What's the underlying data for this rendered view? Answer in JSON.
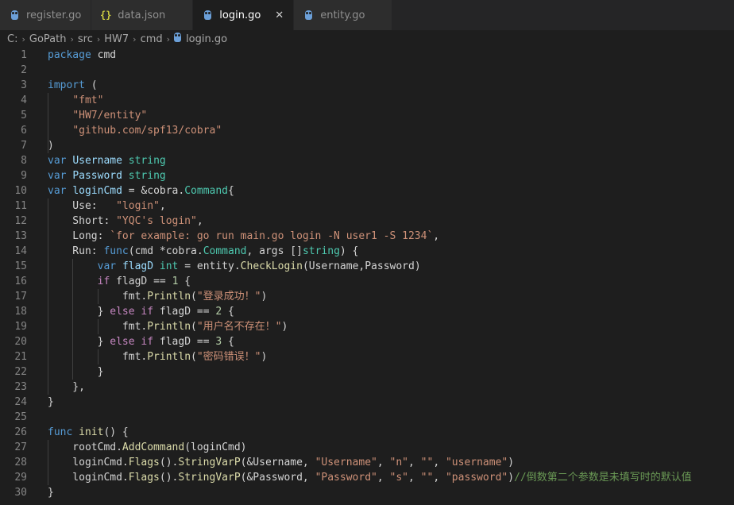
{
  "tabs": [
    {
      "label": "register.go",
      "icon": "go-gopher-icon",
      "active": false
    },
    {
      "label": "data.json",
      "icon": "json-braces-icon",
      "active": false
    },
    {
      "label": "login.go",
      "icon": "go-gopher-icon",
      "active": true,
      "close": "✕"
    },
    {
      "label": "entity.go",
      "icon": "go-gopher-icon",
      "active": false
    }
  ],
  "breadcrumb": {
    "items": [
      "C:",
      "GoPath",
      "src",
      "HW7",
      "cmd"
    ],
    "file": "login.go",
    "separator": "›"
  },
  "colors": {
    "keyword": "#569cd6",
    "control": "#c586c0",
    "string": "#ce9178",
    "type": "#4ec9b0",
    "function": "#dcdcaa",
    "variable": "#9cdcfe",
    "number": "#b5cea8",
    "comment": "#6a9955",
    "text": "#d4d4d4"
  },
  "code": [
    {
      "n": "1",
      "t": [
        [
          "kw",
          "package"
        ],
        [
          "txt",
          " cmd"
        ]
      ]
    },
    {
      "n": "2",
      "t": []
    },
    {
      "n": "3",
      "t": [
        [
          "kw",
          "import"
        ],
        [
          "txt",
          " ("
        ]
      ]
    },
    {
      "n": "4",
      "t": [
        [
          "txt",
          "    "
        ],
        [
          "str",
          "\"fmt\""
        ]
      ]
    },
    {
      "n": "5",
      "t": [
        [
          "txt",
          "    "
        ],
        [
          "str",
          "\"HW7/entity\""
        ]
      ]
    },
    {
      "n": "6",
      "t": [
        [
          "txt",
          "    "
        ],
        [
          "str",
          "\"github.com/spf13/cobra\""
        ]
      ]
    },
    {
      "n": "7",
      "t": [
        [
          "txt",
          ")"
        ]
      ]
    },
    {
      "n": "8",
      "t": [
        [
          "kw",
          "var"
        ],
        [
          "txt",
          " "
        ],
        [
          "var",
          "Username"
        ],
        [
          "txt",
          " "
        ],
        [
          "typ",
          "string"
        ]
      ]
    },
    {
      "n": "9",
      "t": [
        [
          "kw",
          "var"
        ],
        [
          "txt",
          " "
        ],
        [
          "var",
          "Password"
        ],
        [
          "txt",
          " "
        ],
        [
          "typ",
          "string"
        ]
      ]
    },
    {
      "n": "10",
      "t": [
        [
          "kw",
          "var"
        ],
        [
          "txt",
          " "
        ],
        [
          "var",
          "loginCmd"
        ],
        [
          "txt",
          " = &cobra."
        ],
        [
          "typ",
          "Command"
        ],
        [
          "txt",
          "{"
        ]
      ]
    },
    {
      "n": "11",
      "t": [
        [
          "txt",
          "    Use:   "
        ],
        [
          "str",
          "\"login\""
        ],
        [
          "txt",
          ","
        ]
      ]
    },
    {
      "n": "12",
      "t": [
        [
          "txt",
          "    Short: "
        ],
        [
          "str",
          "\"YQC's login\""
        ],
        [
          "txt",
          ","
        ]
      ]
    },
    {
      "n": "13",
      "t": [
        [
          "txt",
          "    Long: "
        ],
        [
          "str",
          "`for example: go run main.go login -N user1 -S 1234`"
        ],
        [
          "txt",
          ","
        ]
      ]
    },
    {
      "n": "14",
      "t": [
        [
          "txt",
          "    Run: "
        ],
        [
          "kw",
          "func"
        ],
        [
          "txt",
          "(cmd *cobra."
        ],
        [
          "typ",
          "Command"
        ],
        [
          "txt",
          ", args []"
        ],
        [
          "typ",
          "string"
        ],
        [
          "txt",
          ") {"
        ]
      ]
    },
    {
      "n": "15",
      "t": [
        [
          "txt",
          "        "
        ],
        [
          "kw",
          "var"
        ],
        [
          "txt",
          " "
        ],
        [
          "var",
          "flagD"
        ],
        [
          "txt",
          " "
        ],
        [
          "typ",
          "int"
        ],
        [
          "txt",
          " = entity."
        ],
        [
          "fn",
          "CheckLogin"
        ],
        [
          "txt",
          "(Username,Password)"
        ]
      ]
    },
    {
      "n": "16",
      "t": [
        [
          "txt",
          "        "
        ],
        [
          "ctl",
          "if"
        ],
        [
          "txt",
          " flagD == "
        ],
        [
          "num",
          "1"
        ],
        [
          "txt",
          " {"
        ]
      ]
    },
    {
      "n": "17",
      "t": [
        [
          "txt",
          "            fmt."
        ],
        [
          "fn",
          "Println"
        ],
        [
          "txt",
          "("
        ],
        [
          "str",
          "\"登录成功！\""
        ],
        [
          "txt",
          ")"
        ]
      ]
    },
    {
      "n": "18",
      "t": [
        [
          "txt",
          "        } "
        ],
        [
          "ctl",
          "else"
        ],
        [
          "txt",
          " "
        ],
        [
          "ctl",
          "if"
        ],
        [
          "txt",
          " flagD == "
        ],
        [
          "num",
          "2"
        ],
        [
          "txt",
          " {"
        ]
      ]
    },
    {
      "n": "19",
      "t": [
        [
          "txt",
          "            fmt."
        ],
        [
          "fn",
          "Println"
        ],
        [
          "txt",
          "("
        ],
        [
          "str",
          "\"用户名不存在！\""
        ],
        [
          "txt",
          ")"
        ]
      ]
    },
    {
      "n": "20",
      "t": [
        [
          "txt",
          "        } "
        ],
        [
          "ctl",
          "else"
        ],
        [
          "txt",
          " "
        ],
        [
          "ctl",
          "if"
        ],
        [
          "txt",
          " flagD == "
        ],
        [
          "num",
          "3"
        ],
        [
          "txt",
          " {"
        ]
      ]
    },
    {
      "n": "21",
      "t": [
        [
          "txt",
          "            fmt."
        ],
        [
          "fn",
          "Println"
        ],
        [
          "txt",
          "("
        ],
        [
          "str",
          "\"密码错误！\""
        ],
        [
          "txt",
          ")"
        ]
      ]
    },
    {
      "n": "22",
      "t": [
        [
          "txt",
          "        }"
        ]
      ]
    },
    {
      "n": "23",
      "t": [
        [
          "txt",
          "    },"
        ]
      ]
    },
    {
      "n": "24",
      "t": [
        [
          "txt",
          "}"
        ]
      ]
    },
    {
      "n": "25",
      "t": []
    },
    {
      "n": "26",
      "t": [
        [
          "kw",
          "func"
        ],
        [
          "txt",
          " "
        ],
        [
          "fn",
          "init"
        ],
        [
          "txt",
          "() {"
        ]
      ]
    },
    {
      "n": "27",
      "t": [
        [
          "txt",
          "    rootCmd."
        ],
        [
          "fn",
          "AddCommand"
        ],
        [
          "txt",
          "(loginCmd)"
        ]
      ]
    },
    {
      "n": "28",
      "t": [
        [
          "txt",
          "    loginCmd."
        ],
        [
          "fn",
          "Flags"
        ],
        [
          "txt",
          "()."
        ],
        [
          "fn",
          "StringVarP"
        ],
        [
          "txt",
          "(&Username, "
        ],
        [
          "str",
          "\"Username\""
        ],
        [
          "txt",
          ", "
        ],
        [
          "str",
          "\"n\""
        ],
        [
          "txt",
          ", "
        ],
        [
          "str",
          "\"\""
        ],
        [
          "txt",
          ", "
        ],
        [
          "str",
          "\"username\""
        ],
        [
          "txt",
          ")"
        ]
      ]
    },
    {
      "n": "29",
      "t": [
        [
          "txt",
          "    loginCmd."
        ],
        [
          "fn",
          "Flags"
        ],
        [
          "txt",
          "()."
        ],
        [
          "fn",
          "StringVarP"
        ],
        [
          "txt",
          "(&Password, "
        ],
        [
          "str",
          "\"Password\""
        ],
        [
          "txt",
          ", "
        ],
        [
          "str",
          "\"s\""
        ],
        [
          "txt",
          ", "
        ],
        [
          "str",
          "\"\""
        ],
        [
          "txt",
          ", "
        ],
        [
          "str",
          "\"password\""
        ],
        [
          "txt",
          ")"
        ],
        [
          "cmt",
          "//倒数第二个参数是未填写时的默认值"
        ]
      ]
    },
    {
      "n": "30",
      "t": [
        [
          "txt",
          "}"
        ]
      ]
    }
  ]
}
